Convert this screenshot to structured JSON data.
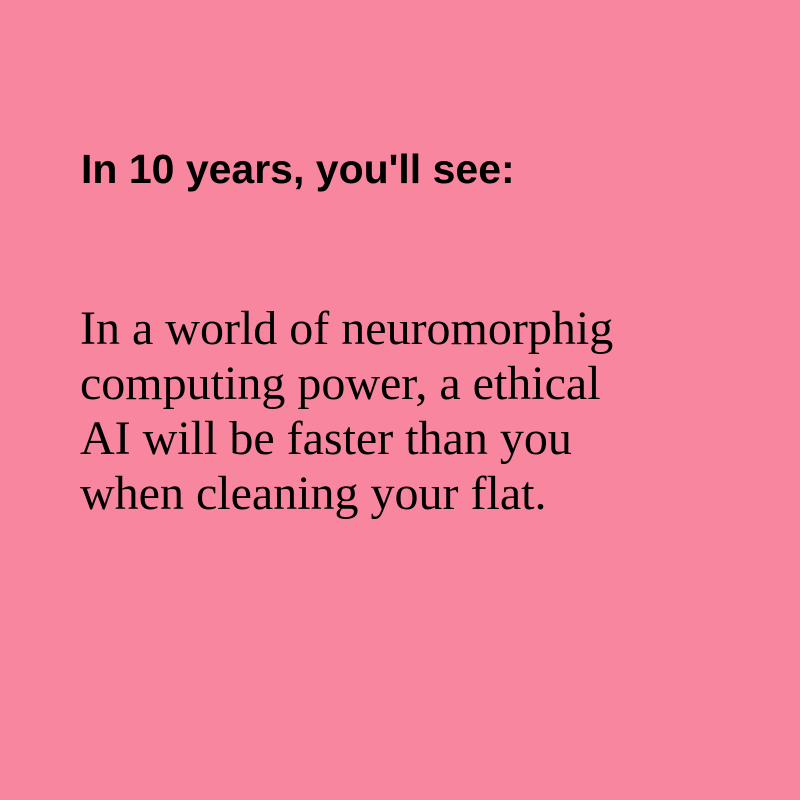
{
  "heading": "In 10 years, you'll see:",
  "body_lines": [
    "In a world of neuromorphig",
    "computing power, a ethical",
    "AI will be faster than you",
    "when cleaning your flat."
  ],
  "colors": {
    "background": "#f8869e",
    "text": "#000000"
  }
}
